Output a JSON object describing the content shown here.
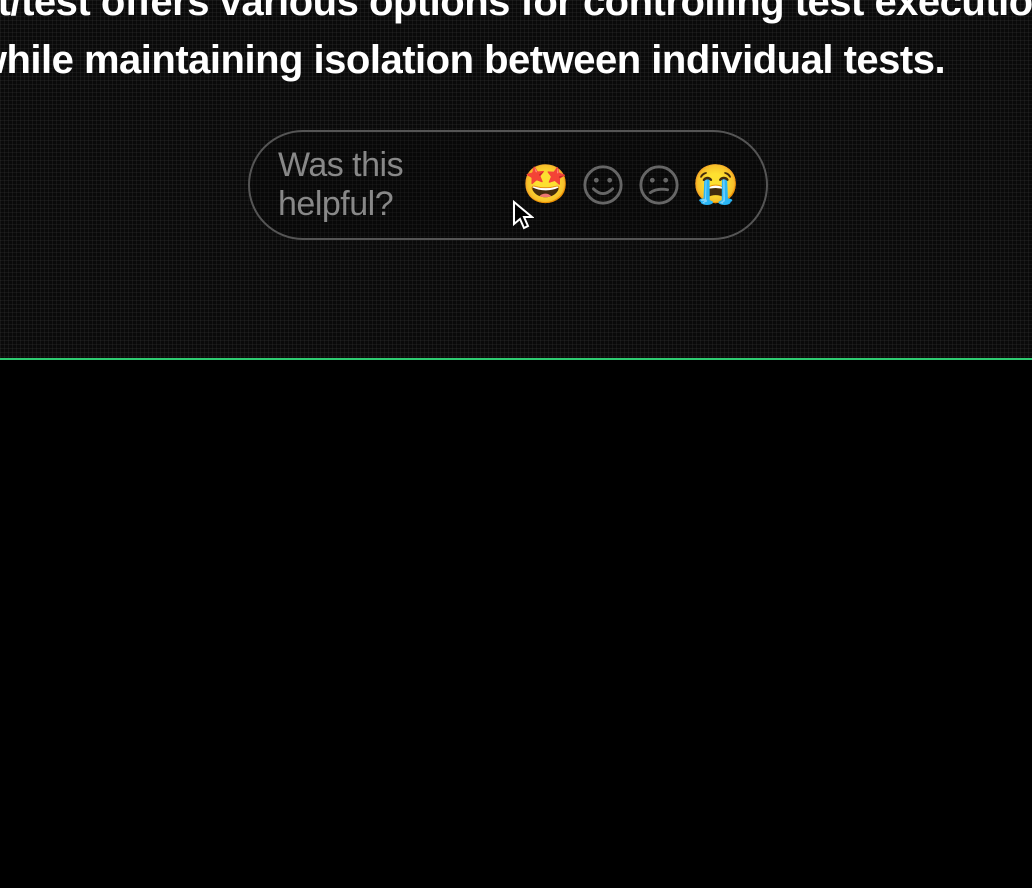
{
  "content": {
    "line1": "aywright/test offers various options for controlling test execution",
    "line2": "ses while maintaining isolation between individual tests."
  },
  "feedback": {
    "label": "Was this helpful?",
    "options": [
      {
        "name": "starry-eyes",
        "emoji": "🤩"
      },
      {
        "name": "grin",
        "emoji": "grin-face"
      },
      {
        "name": "confused",
        "emoji": "confused-face"
      },
      {
        "name": "crying",
        "emoji": "😭"
      }
    ]
  }
}
